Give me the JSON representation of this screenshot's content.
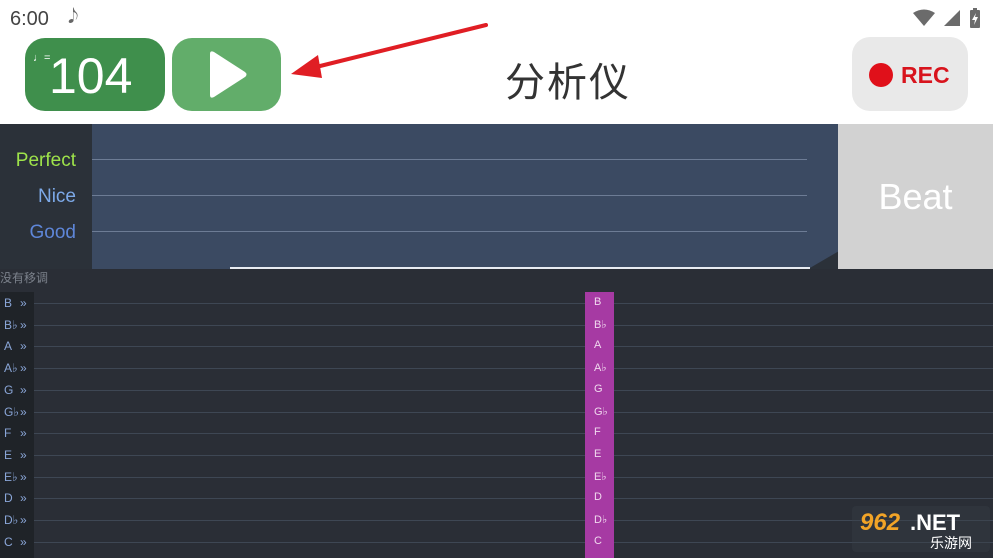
{
  "status_bar": {
    "time": "6:00",
    "note_glyph": "𝅘𝅥𝅮"
  },
  "toolbar": {
    "tempo_note": "♩=",
    "tempo_value": "104",
    "play_icon": "play-icon",
    "title": "分析仪",
    "rec_label": "REC"
  },
  "accuracy": {
    "labels": [
      {
        "text": "Perfect",
        "color": "#9ee34a"
      },
      {
        "text": "Nice",
        "color": "#7da9e8"
      },
      {
        "text": "Good",
        "color": "#5e86d8"
      }
    ],
    "beat_label": "Beat"
  },
  "piano_roll": {
    "caption": "没有移调",
    "notes": [
      "B",
      "B♭",
      "A",
      "A♭",
      "G",
      "G♭",
      "F",
      "E",
      "E♭",
      "D",
      "D♭",
      "C"
    ],
    "key_suffix": "»"
  },
  "watermark": {
    "brand": "962.NET",
    "sub": "乐游网"
  },
  "colors": {
    "tempo_bg": "#3f8f4c",
    "play_bg": "#62ad6a",
    "rec_red": "#e0101a",
    "playhead": "#a63aa3",
    "panel_bg": "#3b4a62"
  }
}
